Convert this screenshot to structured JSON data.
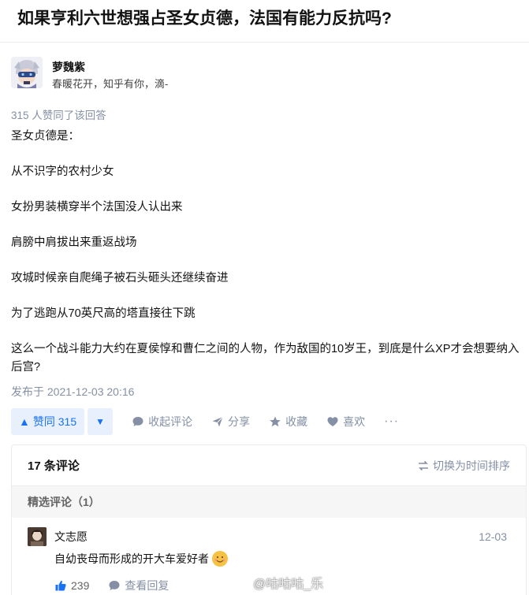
{
  "question": {
    "title": "如果亨利六世想强占圣女贞德，法国有能力反抗吗?"
  },
  "author": {
    "name": "萝魏紫",
    "bio": "春暖花开，知乎有你，滴-",
    "avatar_icon": "anime-avatar-icon"
  },
  "votes_line": "315 人赞同了该回答",
  "answer": {
    "paragraphs": [
      "圣女贞德是：",
      "从不识字的农村少女",
      "女扮男装横穿半个法国没人认出来",
      "肩膀中肩拔出来重返战场",
      "攻城时候亲自爬绳子被石头砸头还继续奋进",
      "为了逃跑从70英尺高的塔直接往下跳",
      "这么一个战斗能力大约在夏侯惇和曹仁之间的人物，作为敌国的10岁王，到底是什么XP才会想要纳入后宫?"
    ]
  },
  "published": "发布于 2021-12-03 20:16",
  "actions": {
    "vote_up": "赞同 315",
    "collapse_comments": "收起评论",
    "share": "分享",
    "favorite": "收藏",
    "like": "喜欢",
    "more": "···"
  },
  "comments": {
    "count_label": "17 条评论",
    "sort_label": "切换为时间排序",
    "featured_label": "精选评论（1）",
    "items": [
      {
        "user": "文志愿",
        "date": "12-03",
        "text": "自幼丧母而形成的开大车爱好者",
        "likes": "239",
        "reply_label": "查看回复"
      }
    ]
  },
  "watermark": "@咕咕咕_乐",
  "colors": {
    "accent": "#1772f6",
    "accent_bg": "#e9f0fd",
    "meta_gray": "#8590a6"
  }
}
